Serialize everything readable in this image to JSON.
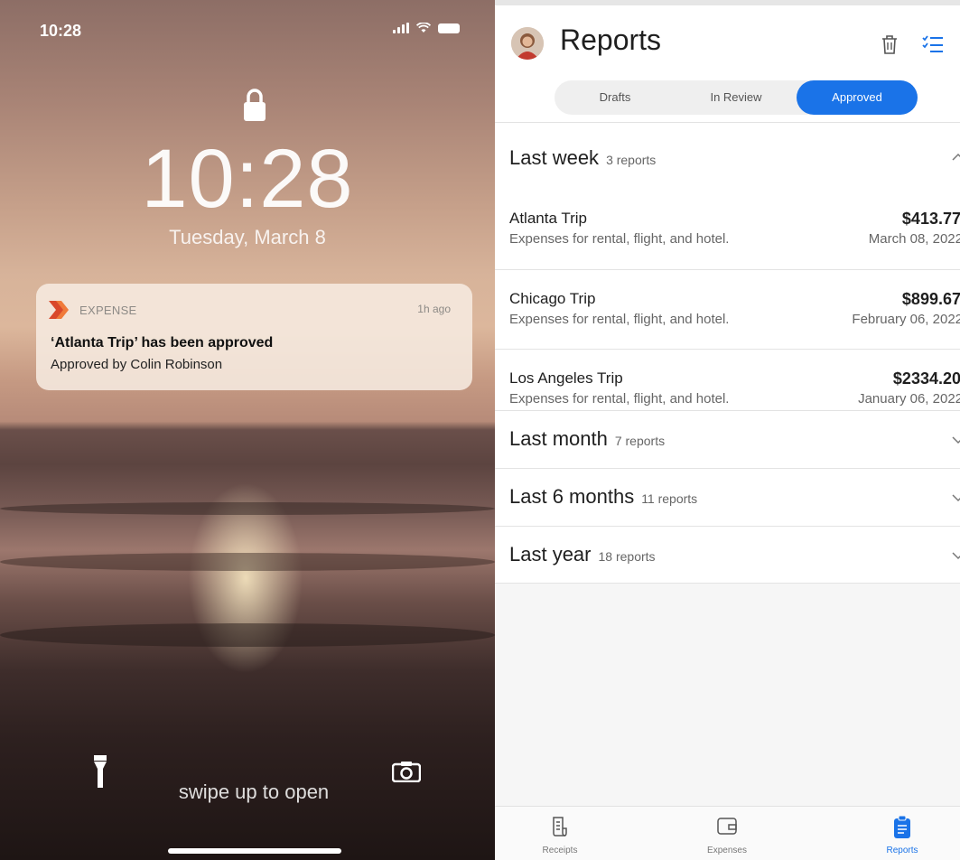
{
  "lock_screen": {
    "status_time": "10:28",
    "big_time": "10:28",
    "date": "Tuesday, March 8",
    "notification": {
      "app_name": "EXPENSE",
      "time_ago": "1h ago",
      "title": "‘Atlanta Trip’ has been approved",
      "body": "Approved by Colin Robinson"
    },
    "swipe_hint": "swipe up to open"
  },
  "app": {
    "title": "Reports",
    "tabs": [
      {
        "label": "Drafts"
      },
      {
        "label": "In Review"
      },
      {
        "label": "Approved",
        "selected": true
      }
    ],
    "sections": [
      {
        "title": "Last week",
        "count": "3 reports",
        "expanded": true,
        "items": [
          {
            "title": "Atlanta Trip",
            "description": "Expenses for rental, flight, and hotel.",
            "amount": "$413.77",
            "date": "March 08, 2022"
          },
          {
            "title": "Chicago Trip",
            "description": "Expenses for rental, flight, and hotel.",
            "amount": "$899.67",
            "date": "February 06, 2022"
          },
          {
            "title": "Los Angeles Trip",
            "description": "Expenses for rental, flight, and hotel.",
            "amount": "$2334.20",
            "date": "January 06, 2022"
          }
        ]
      },
      {
        "title": "Last month",
        "count": "7 reports",
        "expanded": false
      },
      {
        "title": "Last 6 months",
        "count": "11 reports",
        "expanded": false
      },
      {
        "title": "Last year",
        "count": "18 reports",
        "expanded": false
      }
    ],
    "bottom_nav": [
      {
        "label": "Receipts",
        "icon": "receipt-icon"
      },
      {
        "label": "Expenses",
        "icon": "wallet-icon"
      },
      {
        "label": "Reports",
        "icon": "clipboard-icon",
        "active": true
      }
    ],
    "accent_color": "#1a73e8"
  }
}
